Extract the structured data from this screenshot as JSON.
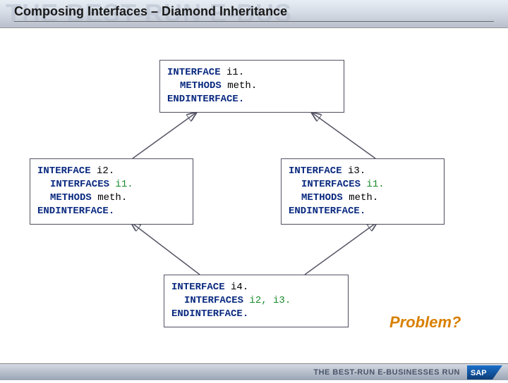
{
  "header": {
    "bg_text": "THE BEST-RUN E-BUS",
    "title": "Composing Interfaces – Diamond Inheritance"
  },
  "box_i1": {
    "l1_kw": "INTERFACE",
    "l1_id": "i1.",
    "l2_kw": "METHODS",
    "l2_id": "meth.",
    "l3_kw": "ENDINTERFACE."
  },
  "box_i2": {
    "l1_kw": "INTERFACE",
    "l1_id": "i2.",
    "l2_kw": "INTERFACES",
    "l2_id": "i1.",
    "l3_kw": "METHODS",
    "l3_id": "meth.",
    "l4_kw": "ENDINTERFACE."
  },
  "box_i3": {
    "l1_kw": "INTERFACE",
    "l1_id": "i3.",
    "l2_kw": "INTERFACES",
    "l2_id": "i1.",
    "l3_kw": "METHODS",
    "l3_id": "meth.",
    "l4_kw": "ENDINTERFACE."
  },
  "box_i4": {
    "l1_kw": "INTERFACE",
    "l1_id": "i4.",
    "l2_kw": "INTERFACES",
    "l2_id": "i2, i3.",
    "l3_kw": "ENDINTERFACE."
  },
  "problem_label": "Problem?",
  "footer": {
    "text": "THE BEST-RUN E-BUSINESSES RUN",
    "logo_text": "SAP"
  }
}
